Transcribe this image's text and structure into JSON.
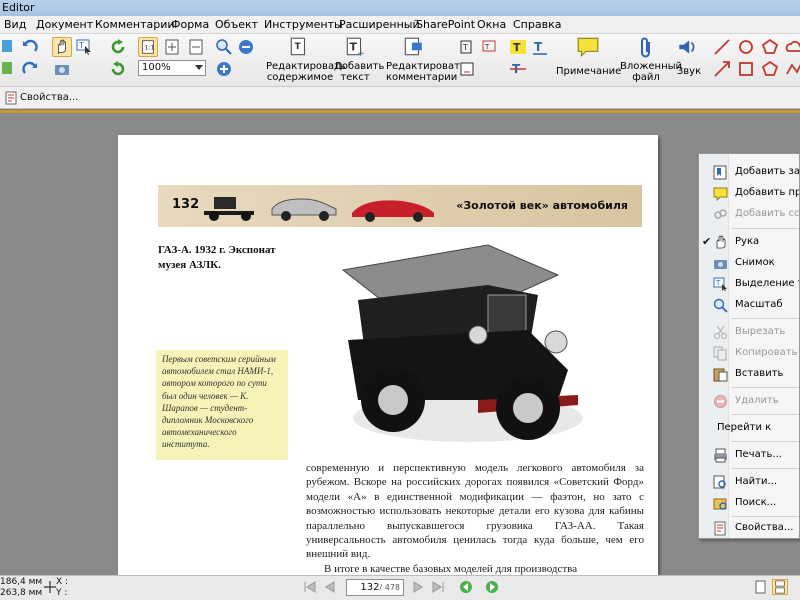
{
  "window": {
    "title": "Editor"
  },
  "menu": [
    "Вид",
    "Документ",
    "Комментарии",
    "Форма",
    "Объект",
    "Инструменты",
    "Расширенный",
    "SharePoint",
    "Окна",
    "Справка"
  ],
  "toolbar": {
    "zoom": "100%",
    "edit_content": "Редактировать содержимое",
    "add_text": "Добавить текст",
    "edit_comments": "Редактировать комментарии",
    "note": "Примечание",
    "attachment": "Вложенный файл",
    "sound": "Звук"
  },
  "properties_bar": {
    "label": "Свойства..."
  },
  "document": {
    "banner_number": "132",
    "banner_title": "«Золотой век» автомобиля",
    "caption": "ГАЗ-А. 1932 г. Экспонат музея АЗЛК.",
    "sidenote": "Первым советским серийным автомобилем стал НАМИ-1, автором которого по сути был один человек — К. Шарапов — студент-дипломник Московского автомеханического института.",
    "body_p1": "современную и перспективную модель легкового автомобиля за рубежом. Вскоре на российских дорогах появился «Советский Форд» модели «А» в единственной модификации — фаэтон, но зато с возможностью использовать некоторые детали его кузова для кабины параллельно выпускавшегося грузовика ГАЗ-АА. Такая универсальность автомобиля ценилась тогда куда больше, чем его внешний вид.",
    "body_p2": "В итоге в качестве базовых моделей для производства"
  },
  "context_menu": {
    "items": [
      {
        "label": "Добавить закладку",
        "icon": "bookmark-add-icon",
        "disabled": false
      },
      {
        "label": "Добавить примечание",
        "icon": "note-add-icon",
        "disabled": false
      },
      {
        "label": "Добавить ссылку",
        "icon": "link-add-icon",
        "disabled": true
      },
      {
        "label": "Рука",
        "icon": "hand-icon",
        "disabled": false,
        "checked": true
      },
      {
        "label": "Снимок",
        "icon": "camera-icon",
        "disabled": false
      },
      {
        "label": "Выделение текста",
        "icon": "text-select-icon",
        "disabled": false
      },
      {
        "label": "Масштаб",
        "icon": "zoom-icon",
        "disabled": false
      },
      {
        "label": "Вырезать",
        "icon": "cut-icon",
        "disabled": true
      },
      {
        "label": "Копировать",
        "icon": "copy-icon",
        "disabled": true
      },
      {
        "label": "Вставить",
        "icon": "paste-icon",
        "disabled": false
      },
      {
        "label": "Удалить",
        "icon": "delete-icon",
        "disabled": true
      },
      {
        "label": "Перейти к",
        "icon": "",
        "disabled": false
      },
      {
        "label": "Печать...",
        "icon": "print-icon",
        "disabled": false
      },
      {
        "label": "Найти...",
        "icon": "find-icon",
        "disabled": false
      },
      {
        "label": "Поиск...",
        "icon": "search-icon",
        "disabled": false
      },
      {
        "label": "Свойства...",
        "icon": "properties-icon",
        "disabled": false
      }
    ]
  },
  "status": {
    "width": "186,4 мм",
    "height": "263,8 мм",
    "x_label": "X :",
    "y_label": "Y :",
    "current_page": "132",
    "total_pages": "/ 478"
  },
  "colors": {
    "banner": "#e0ceae",
    "sidenote": "#f6f3b8",
    "accent": "#c49a2c"
  }
}
